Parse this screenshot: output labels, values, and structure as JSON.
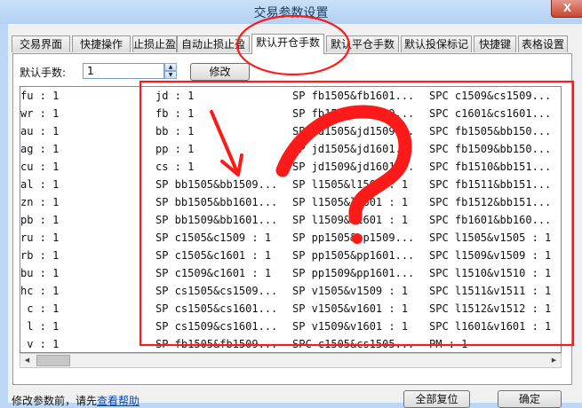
{
  "window": {
    "title": "交易参数设置",
    "close_glyph": "X"
  },
  "tabs": [
    "交易界面",
    "快捷操作",
    "止损止盈",
    "自动止损止盈",
    "默认开仓手数",
    "默认平仓手数",
    "默认投保标记",
    "快捷键",
    "表格设置"
  ],
  "active_tab": 4,
  "form": {
    "label": "默认手数:",
    "value": "1",
    "modify_button": "修改"
  },
  "grid": {
    "rows": [
      [
        "fu : 1",
        "jd : 1",
        "SP fb1505&fb1601...",
        "SPC c1509&cs1509..."
      ],
      [
        "wr : 1",
        "fb : 1",
        "SP fb1505&fb1509...",
        "SPC c1601&cs1601..."
      ],
      [
        "au : 1",
        "bb : 1",
        "SP jd1505&jd1509...",
        "SPC fb1505&bb150..."
      ],
      [
        "ag : 1",
        "pp : 1",
        "SP jd1505&jd1601...",
        "SPC fb1509&bb150..."
      ],
      [
        "cu : 1",
        "cs : 1",
        "SP jd1509&jd1601...",
        "SPC fb1510&bb151..."
      ],
      [
        "al : 1",
        "SP bb1505&bb1509...",
        "SP l1505&l1509 : 1",
        "SPC fb1511&bb151..."
      ],
      [
        "zn : 1",
        "SP bb1505&bb1601...",
        "SP l1505&l1601 : 1",
        "SPC fb1512&bb151..."
      ],
      [
        "pb : 1",
        "SP bb1509&bb1601...",
        "SP l1509&l1601 : 1",
        "SPC fb1601&bb160..."
      ],
      [
        "ru : 1",
        "SP c1505&c1509 : 1",
        "SP pp1505&pp1509...",
        "SPC l1505&v1505 : 1"
      ],
      [
        "rb : 1",
        "SP c1505&c1601 : 1",
        "SP pp1505&pp1601...",
        "SPC l1509&v1509 : 1"
      ],
      [
        "bu : 1",
        "SP c1509&c1601 : 1",
        "SP pp1509&pp1601...",
        "SPC l1510&v1510 : 1"
      ],
      [
        "hc : 1",
        "SP cs1505&cs1509...",
        "SP v1505&v1509 : 1",
        "SPC l1511&v1511 : 1"
      ],
      [
        " c : 1",
        "SP cs1505&cs1601...",
        "SP v1505&v1601 : 1",
        "SPC l1512&v1512 : 1"
      ],
      [
        " l : 1",
        "SP cs1509&cs1601...",
        "SP v1509&v1601 : 1",
        "SPC l1601&v1601 : 1"
      ],
      [
        " v : 1",
        "SP fb1505&fb1509...",
        "SPC c1505&cs1505...",
        "PM : 1"
      ]
    ]
  },
  "footer": {
    "hint_prefix": "修改参数前，请先",
    "help_link": "查看帮助",
    "reset_button": "全部复位",
    "ok_button": "确定"
  },
  "annotation_colors": {
    "red": "#ff1a1a"
  }
}
